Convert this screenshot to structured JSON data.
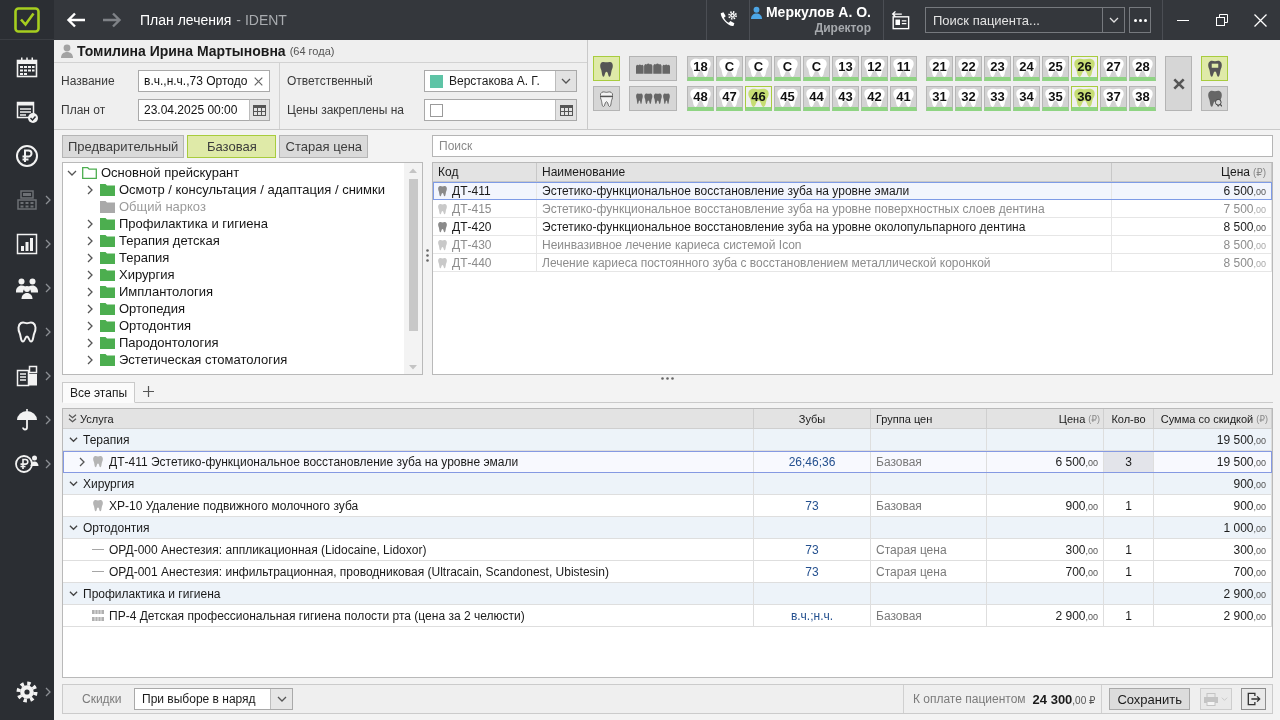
{
  "window": {
    "title": "План лечения",
    "app_name": "- IDENT"
  },
  "nav": [
    {
      "submenu": false,
      "disabled": false
    },
    {
      "submenu": false,
      "disabled": false
    },
    {
      "submenu": false,
      "disabled": false
    },
    {
      "submenu": true,
      "disabled": true
    },
    {
      "submenu": true,
      "disabled": false
    },
    {
      "submenu": true,
      "disabled": false
    },
    {
      "submenu": true,
      "disabled": false
    },
    {
      "submenu": true,
      "disabled": false
    },
    {
      "submenu": true,
      "disabled": false
    },
    {
      "submenu": true,
      "disabled": false
    }
  ],
  "settings": {
    "submenu": true
  },
  "user": {
    "name": "Меркулов А. О.",
    "role": "Директор"
  },
  "patient_search": {
    "placeholder": "Поиск пациента..."
  },
  "patient": {
    "name": "Томилина Ирина Мартыновна",
    "age": "(64 года)"
  },
  "plan_form": {
    "name": {
      "label": "Название",
      "value": "в.ч.,н.ч.,73 Ортодо"
    },
    "date": {
      "label": "План от",
      "value": "23.04.2025 00:00"
    },
    "responsible": {
      "label": "Ответственный",
      "value": "Верстакова А. Г.",
      "color": "#5ec4a6"
    },
    "prices_fixed": {
      "label": "Цены закреплены на",
      "checked": false
    }
  },
  "tooth_tools": [
    {
      "selected": true
    },
    {
      "selected": false
    }
  ],
  "jaw_tools": [
    {
      "selected": false
    },
    {
      "selected": false
    }
  ],
  "teeth_rows": [
    {
      "left": [
        {
          "label": "18",
          "selected": false
        },
        {
          "label": "С",
          "selected": false
        },
        {
          "label": "С",
          "selected": false
        },
        {
          "label": "С",
          "selected": false
        },
        {
          "label": "С",
          "selected": false
        },
        {
          "label": "13",
          "selected": false
        },
        {
          "label": "12",
          "selected": false
        },
        {
          "label": "11",
          "selected": false
        }
      ],
      "right": [
        {
          "label": "21",
          "selected": false
        },
        {
          "label": "22",
          "selected": false
        },
        {
          "label": "23",
          "selected": false
        },
        {
          "label": "24",
          "selected": false
        },
        {
          "label": "25",
          "selected": false
        },
        {
          "label": "26",
          "selected": true
        },
        {
          "label": "27",
          "selected": false
        },
        {
          "label": "28",
          "selected": false
        }
      ]
    },
    {
      "left": [
        {
          "label": "48",
          "selected": false
        },
        {
          "label": "47",
          "selected": false
        },
        {
          "label": "46",
          "selected": true
        },
        {
          "label": "45",
          "selected": false
        },
        {
          "label": "44",
          "selected": false
        },
        {
          "label": "43",
          "selected": false
        },
        {
          "label": "42",
          "selected": false
        },
        {
          "label": "41",
          "selected": false
        }
      ],
      "right": [
        {
          "label": "31",
          "selected": false
        },
        {
          "label": "32",
          "selected": false
        },
        {
          "label": "33",
          "selected": false
        },
        {
          "label": "34",
          "selected": false
        },
        {
          "label": "35",
          "selected": false
        },
        {
          "label": "36",
          "selected": true
        },
        {
          "label": "37",
          "selected": false
        },
        {
          "label": "38",
          "selected": false
        }
      ]
    }
  ],
  "side_tools": [
    {
      "selected": true
    },
    {
      "selected": false
    }
  ],
  "price_tabs": [
    {
      "label": "Предварительный",
      "selected": false
    },
    {
      "label": "Базовая",
      "selected": true
    },
    {
      "label": "Старая цена",
      "selected": false
    }
  ],
  "price_tree": [
    {
      "label": "Основной прейскурант",
      "expanded": true,
      "has_children": true,
      "disabled": false,
      "children": [
        {
          "label": "Осмотр / консультация / адаптация / снимки",
          "expanded": false,
          "has_children": true,
          "disabled": false
        },
        {
          "label": "Общий наркоз",
          "expanded": false,
          "has_children": false,
          "disabled": true
        },
        {
          "label": "Профилактика и гигиена",
          "expanded": false,
          "has_children": true,
          "disabled": false
        },
        {
          "label": "Терапия детская",
          "expanded": false,
          "has_children": true,
          "disabled": false
        },
        {
          "label": "Терапия",
          "expanded": false,
          "has_children": true,
          "disabled": false
        },
        {
          "label": "Хирургия",
          "expanded": false,
          "has_children": true,
          "disabled": false
        },
        {
          "label": "Имплантология",
          "expanded": false,
          "has_children": true,
          "disabled": false
        },
        {
          "label": "Ортопедия",
          "expanded": false,
          "has_children": true,
          "disabled": false
        },
        {
          "label": "Ортодонтия",
          "expanded": false,
          "has_children": true,
          "disabled": false
        },
        {
          "label": "Пародонтология",
          "expanded": false,
          "has_children": true,
          "disabled": false
        },
        {
          "label": "Эстетическая стоматология",
          "expanded": false,
          "has_children": true,
          "disabled": false
        }
      ]
    }
  ],
  "service_search": {
    "placeholder": "Поиск"
  },
  "services": {
    "columns": [
      {
        "label": "Код"
      },
      {
        "label": "Наименование"
      },
      {
        "label": "Цена",
        "unit": "(₽)"
      }
    ],
    "rows": [
      {
        "code": "ДТ-411",
        "name": "Эстетико-функциональное восстановление зуба на уровне эмали",
        "price": "6 500,00",
        "selected": true,
        "disabled": false
      },
      {
        "code": "ДТ-415",
        "name": "Эстетико-функциональное восстановление зуба на уровне поверхностных слоев дентина",
        "price": "7 500,00",
        "selected": false,
        "disabled": true
      },
      {
        "code": "ДТ-420",
        "name": "Эстетико-функциональное восстановление зуба на уровне околопульпарного дентина",
        "price": "8 500,00",
        "selected": false,
        "disabled": false
      },
      {
        "code": "ДТ-430",
        "name": "Неинвазивное лечение кариеса системой Icon",
        "price": "8 500,00",
        "selected": false,
        "disabled": true
      },
      {
        "code": "ДТ-440",
        "name": "Лечение кариеса постоянного зуба с восстановлением металлической коронкой",
        "price": "8 500,00",
        "selected": false,
        "disabled": true
      }
    ]
  },
  "stage_tabs": [
    {
      "label": "Все этапы",
      "selected": true
    }
  ],
  "plan": {
    "columns": [
      {
        "label": "Услуга"
      },
      {
        "label": "Зубы"
      },
      {
        "label": "Группа цен"
      },
      {
        "label": "Цена",
        "unit": "(₽)"
      },
      {
        "label": "Кол-во"
      },
      {
        "label": "Сумма со скидкой",
        "unit": "(₽)"
      }
    ],
    "groups": [
      {
        "name": "Терапия",
        "expanded": true,
        "total": "19 500,00",
        "items": [
          {
            "kind": "tooth",
            "title": "ДТ-411 Эстетико-функциональное восстановление зуба на уровне эмали",
            "teeth": "26;46;36",
            "price_group": "Базовая",
            "price": "6 500,00",
            "qty": "3",
            "sum": "19 500,00",
            "selected": true,
            "has_children": true
          }
        ]
      },
      {
        "name": "Хирургия",
        "expanded": true,
        "total": "900,00",
        "items": [
          {
            "kind": "tooth",
            "title": "ХР-10 Удаление подвижного молочного зуба",
            "teeth": "73",
            "price_group": "Базовая",
            "price": "900,00",
            "qty": "1",
            "sum": "900,00",
            "selected": false,
            "has_children": false
          }
        ]
      },
      {
        "name": "Ортодонтия",
        "expanded": true,
        "total": "1 000,00",
        "items": [
          {
            "kind": "plain",
            "title": "ОРД-000 Анестезия: аппликационная (Lidocaine, Lidoxor)",
            "teeth": "73",
            "price_group": "Старая цена",
            "price": "300,00",
            "qty": "1",
            "sum": "300,00",
            "selected": false,
            "has_children": false
          },
          {
            "kind": "plain",
            "title": "ОРД-001 Анестезия: инфильтрационная, проводниковая (Ultracain, Scandonest, Ubistesin)",
            "teeth": "73",
            "price_group": "Старая цена",
            "price": "700,00",
            "qty": "1",
            "sum": "700,00",
            "selected": false,
            "has_children": false
          }
        ]
      },
      {
        "name": "Профилактика и гигиена",
        "expanded": true,
        "total": "2 900,00",
        "items": [
          {
            "kind": "jaw",
            "title": "ПР-4 Детская профессиональная гигиена полости рта (цена за 2 челюсти)",
            "teeth": "в.ч.;н.ч.",
            "price_group": "Базовая",
            "price": "2 900,00",
            "qty": "1",
            "sum": "2 900,00",
            "selected": false,
            "has_children": false
          }
        ]
      }
    ]
  },
  "footer": {
    "discount_label": "Скидки",
    "discount_value": "При выборе в наряд",
    "payable_label": "К оплате пациентом",
    "payable_value": "24 300,00 ₽",
    "save": "Сохранить",
    "print_disabled": true
  }
}
